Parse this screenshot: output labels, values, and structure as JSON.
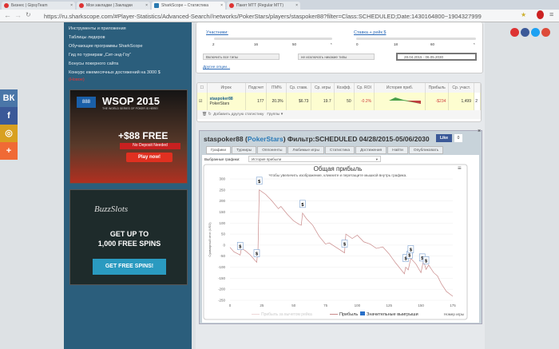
{
  "browser": {
    "tabs": [
      {
        "label": "Бизнес | GipsyTeam"
      },
      {
        "label": "Мои закладки | Закладки"
      },
      {
        "label": "SharkScope – Статистика"
      },
      {
        "label": "Пакет MTT (Regular MTT)"
      }
    ],
    "url": "https://ru.sharkscope.com/#Player-Statistics/Advanced-Search//networks/PokerStars/players/staspoker88?filter=Class:SCHEDULED;Date:1430164800~1904327999"
  },
  "nav": {
    "items": [
      "Инструменты и приложения",
      "Таблицы лидеров",
      "Обучающие программы SharkScope",
      "Гид по турнирам „Сит-энд-Гоу“",
      "Бонусы покерного сайта",
      "Конкурс ежемесячных достижений на 3000 $"
    ],
    "badge": "(Новое)"
  },
  "ads": {
    "wsop": {
      "title": "WSOP 2015",
      "subtitle": "THE WORLD SERIES OF POKER IS HERE!",
      "offer": "+$88 FREE",
      "note": "No Deposit Needed",
      "button": "Play now!"
    },
    "buzz": {
      "logo": "BuzzSlots",
      "line1": "GET UP TO",
      "line2": "1,000 FREE SPINS",
      "button": "GET FREE SPINS!"
    }
  },
  "social": {
    "left": [
      "ВК",
      "f",
      "◎",
      "+"
    ],
    "fb_like": "Like",
    "fb_count": "0"
  },
  "filters": {
    "participants_label": "Участники:",
    "participants_ticks": [
      "2",
      "16",
      "50",
      "*"
    ],
    "stake_label": "Ставка + рейк $",
    "stake_ticks": [
      "0",
      "18",
      "60",
      "*"
    ],
    "include": "Включить все типы",
    "exclude": "не исключать никакие типы",
    "date_range": "28.04.2015 - 06.05.2030",
    "more": "Другие опции..."
  },
  "table": {
    "headers": [
      "Игрок",
      "Подсчет",
      "ITM%",
      "Ср. ставк.",
      "Ср. игры",
      "Коэфф.",
      "Ср. ROI",
      "История приб.",
      "Прибыль",
      "Ср. участ."
    ],
    "row": {
      "player": "staspoker88",
      "network": "PokerStars",
      "count": "177",
      "itm": "20.3%",
      "avg_stake": "$6.73",
      "avg_game": "19.7",
      "coef": "50",
      "roi": "-0.2%",
      "profit": "-$234",
      "avg_part": "1,499",
      "extra": "2"
    },
    "footer": {
      "add_stat": "Добавить другую статистику",
      "groups": "Группы ▾"
    }
  },
  "chartpanel": {
    "player": "staspoker88",
    "network": "PokerStars",
    "filter": "Фильтр:SCHEDULED 04/28/2015-05/06/2030",
    "tabs": [
      "Графики",
      "Турниры",
      "Оппоненты",
      "Любимые игры",
      "Статистика",
      "Достижения",
      "Найти",
      "Опубликовать"
    ],
    "selected_label": "Выбранные графики:",
    "selected_value": "История прибыли"
  },
  "chart_data": {
    "type": "line",
    "title": "Общая прибыль",
    "subtitle": "Чтобы увеличить изображение, кликните и перетащите мышкой внутрь графика.",
    "ylabel": "Суммарный итог (USD)",
    "xlabel": "Номер игры",
    "xlim": [
      0,
      175
    ],
    "ylim": [
      -250,
      300
    ],
    "xticks": [
      0,
      25,
      50,
      75,
      100,
      125,
      150,
      175
    ],
    "yticks": [
      300,
      250,
      200,
      150,
      100,
      50,
      0,
      -50,
      -100,
      -150,
      -200,
      -250
    ],
    "legend": [
      "Прибыль за вычетом рейка",
      "Прибыль",
      "Значительные выигрыши"
    ],
    "line_color": "#c98a8a",
    "points": [
      [
        0,
        -10
      ],
      [
        3,
        -30
      ],
      [
        8,
        -45
      ],
      [
        9,
        -15
      ],
      [
        12,
        -25
      ],
      [
        16,
        -45
      ],
      [
        21,
        -78
      ],
      [
        22,
        -20
      ],
      [
        23,
        250
      ],
      [
        28,
        230
      ],
      [
        33,
        200
      ],
      [
        38,
        165
      ],
      [
        40,
        175
      ],
      [
        45,
        140
      ],
      [
        50,
        110
      ],
      [
        54,
        95
      ],
      [
        56,
        90
      ],
      [
        57,
        145
      ],
      [
        60,
        120
      ],
      [
        65,
        90
      ],
      [
        70,
        40
      ],
      [
        75,
        5
      ],
      [
        78,
        10
      ],
      [
        82,
        -5
      ],
      [
        86,
        -20
      ],
      [
        90,
        -35
      ],
      [
        91,
        50
      ],
      [
        96,
        30
      ],
      [
        100,
        45
      ],
      [
        105,
        15
      ],
      [
        110,
        5
      ],
      [
        115,
        -15
      ],
      [
        120,
        -8
      ],
      [
        125,
        -40
      ],
      [
        130,
        -80
      ],
      [
        137,
        -130
      ],
      [
        138,
        -100
      ],
      [
        140,
        -112
      ],
      [
        142,
        -60
      ],
      [
        146,
        -85
      ],
      [
        150,
        -125
      ],
      [
        152,
        -70
      ],
      [
        154,
        -110
      ],
      [
        156,
        -90
      ],
      [
        160,
        -125
      ],
      [
        163,
        -140
      ],
      [
        166,
        -175
      ],
      [
        170,
        -210
      ],
      [
        175,
        -232
      ]
    ],
    "markers": [
      8,
      21,
      23,
      57,
      90,
      138,
      141,
      142,
      151,
      154
    ]
  }
}
